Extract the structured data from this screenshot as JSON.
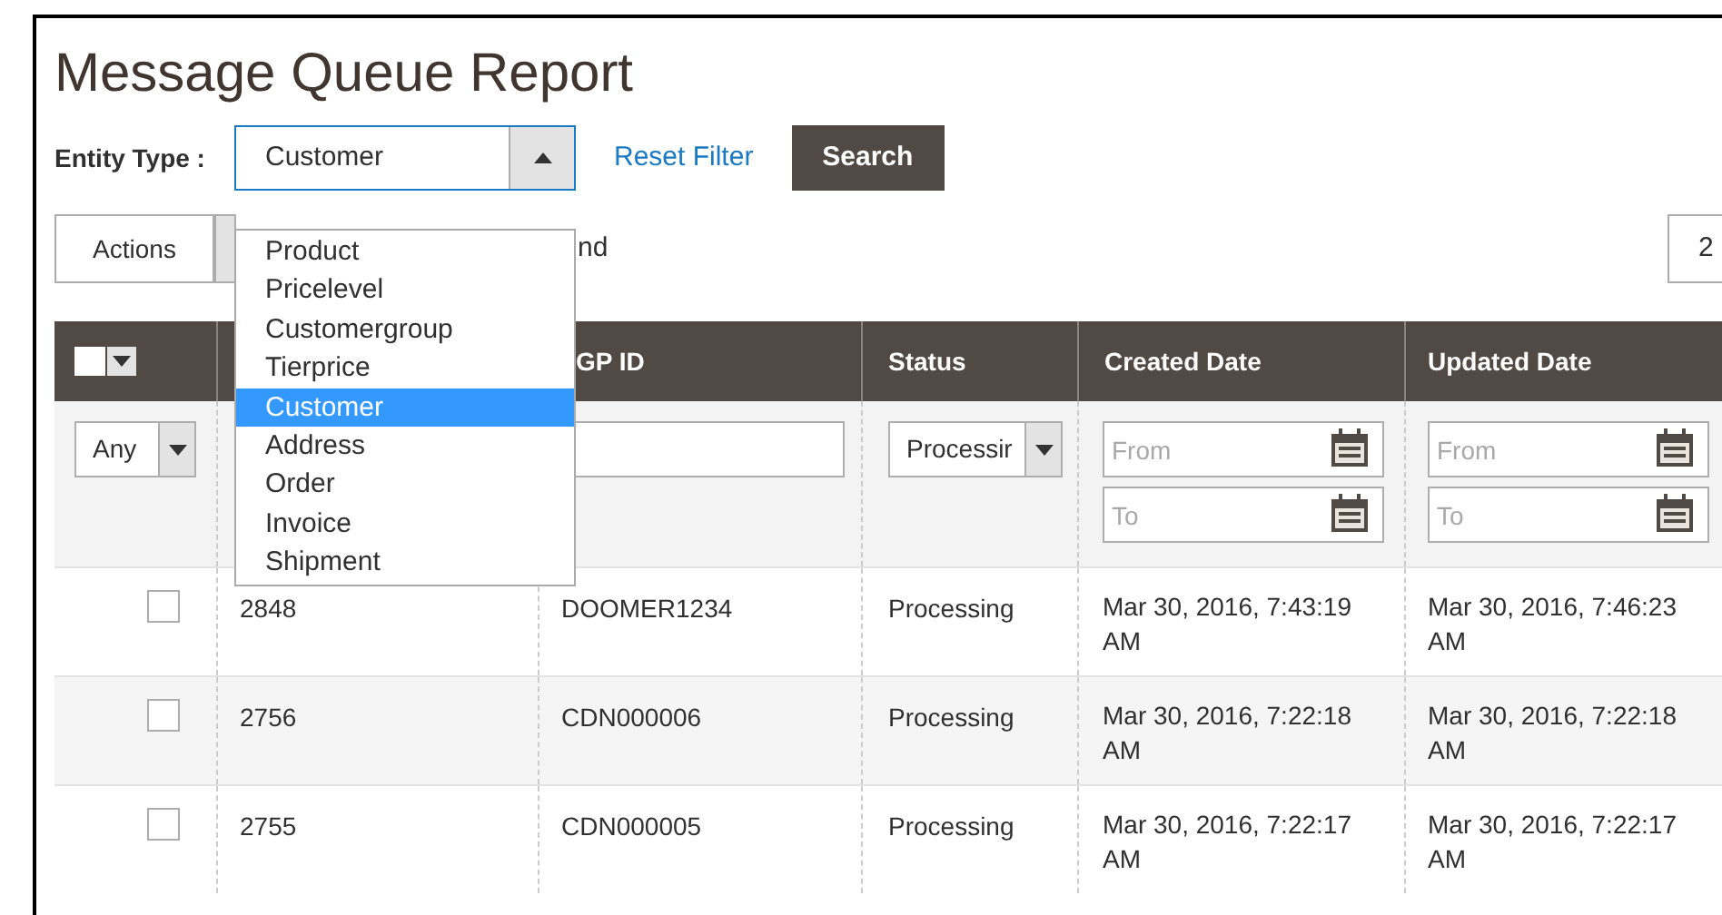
{
  "page_title": "Message Queue Report",
  "filter": {
    "label": "Entity Type :",
    "value": "Customer",
    "expanded": true,
    "options": [
      {
        "label": "Product",
        "selected": false
      },
      {
        "label": "Pricelevel",
        "selected": false
      },
      {
        "label": "Customergroup",
        "selected": false
      },
      {
        "label": "Tierprice",
        "selected": false
      },
      {
        "label": "Customer",
        "selected": true
      },
      {
        "label": "Address",
        "selected": false
      },
      {
        "label": "Order",
        "selected": false
      },
      {
        "label": "Invoice",
        "selected": false
      },
      {
        "label": "Shipment",
        "selected": false
      }
    ],
    "reset_link": "Reset Filter",
    "search_button": "Search"
  },
  "toolbar": {
    "actions_button": "Actions",
    "records_text": "nd",
    "per_page": "2"
  },
  "table": {
    "columns": {
      "gp_id": "GP ID",
      "status": "Status",
      "created": "Created Date",
      "updated": "Updated Date"
    },
    "filters": {
      "mass_select": "Any",
      "status": "Processir",
      "created_from": {
        "placeholder": "From"
      },
      "created_to": {
        "placeholder": "To"
      },
      "updated_from": {
        "placeholder": "From"
      },
      "updated_to": {
        "placeholder": "To"
      }
    },
    "rows": [
      {
        "checked": false,
        "id": "2848",
        "gp_id": "DOOMER1234",
        "status": "Processing",
        "created": "Mar 30, 2016, 7:43:19 AM",
        "updated": "Mar 30, 2016, 7:46:23 AM"
      },
      {
        "checked": false,
        "id": "2756",
        "gp_id": "CDN000006",
        "status": "Processing",
        "created": "Mar 30, 2016, 7:22:18 AM",
        "updated": "Mar 30, 2016, 7:22:18 AM"
      },
      {
        "checked": false,
        "id": "2755",
        "gp_id": "CDN000005",
        "status": "Processing",
        "created": "Mar 30, 2016, 7:22:17 AM",
        "updated": "Mar 30, 2016, 7:22:17 AM"
      }
    ]
  }
}
